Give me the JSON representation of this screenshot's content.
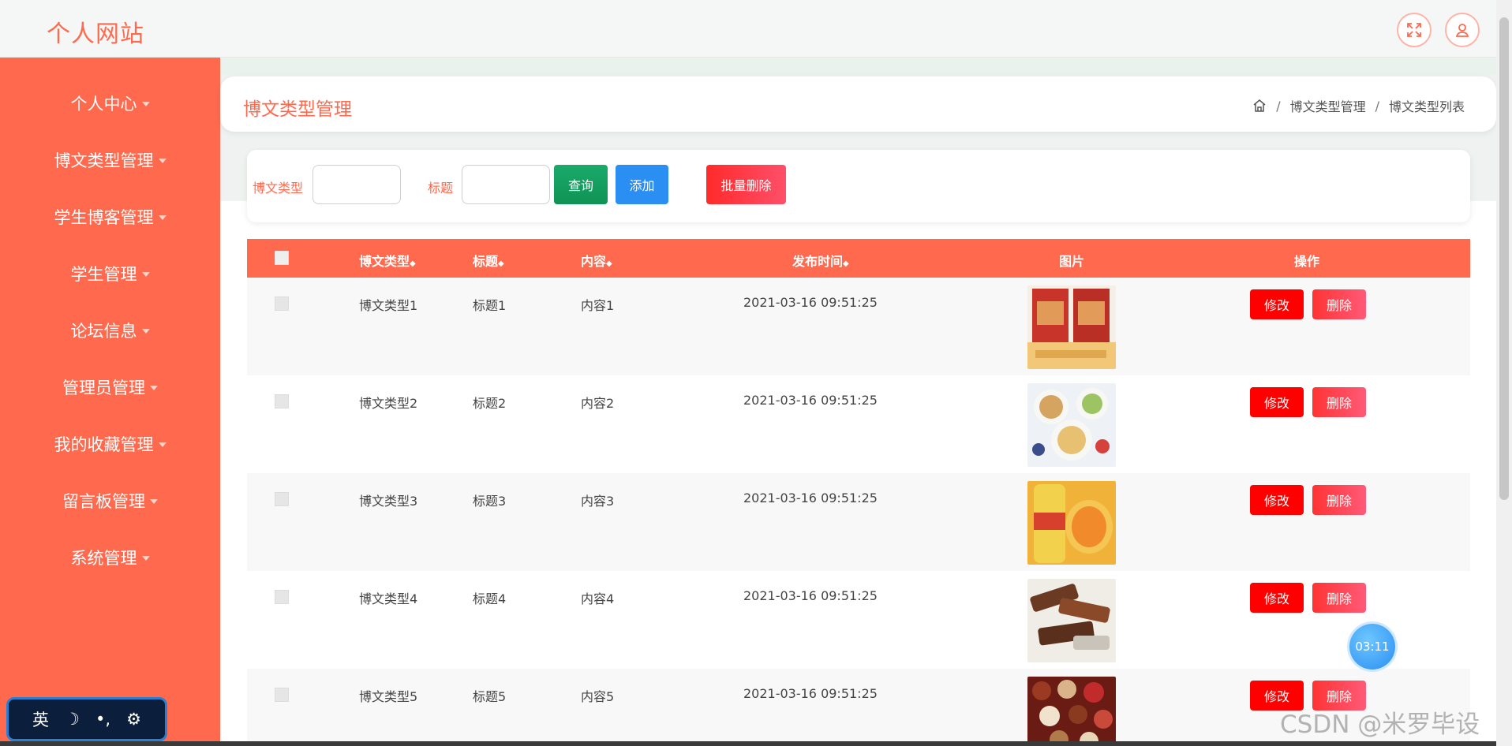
{
  "app": {
    "title": "个人网站"
  },
  "header": {
    "fullscreen_icon": "expand-icon",
    "user_icon": "user-icon"
  },
  "sidebar": {
    "items": [
      {
        "label": "个人中心"
      },
      {
        "label": "博文类型管理"
      },
      {
        "label": "学生博客管理"
      },
      {
        "label": "学生管理"
      },
      {
        "label": "论坛信息"
      },
      {
        "label": "管理员管理"
      },
      {
        "label": "我的收藏管理"
      },
      {
        "label": "留言板管理"
      },
      {
        "label": "系统管理"
      }
    ]
  },
  "page": {
    "title": "博文类型管理",
    "breadcrumb": {
      "level1": "博文类型管理",
      "level2": "博文类型列表"
    }
  },
  "search": {
    "type_label": "博文类型",
    "type_value": "",
    "title_label": "标题",
    "title_value": "",
    "query_label": "查询",
    "add_label": "添加",
    "batch_delete_label": "批量删除"
  },
  "table": {
    "headers": [
      "博文类型",
      "标题",
      "内容",
      "发布时间",
      "图片",
      "操作"
    ],
    "sort_glyph": "◆",
    "edit_label": "修改",
    "delete_label": "删除",
    "rows": [
      {
        "type": "博文类型1",
        "title": "标题1",
        "content": "内容1",
        "time": "2021-03-16 09:51:25"
      },
      {
        "type": "博文类型2",
        "title": "标题2",
        "content": "内容2",
        "time": "2021-03-16 09:51:25"
      },
      {
        "type": "博文类型3",
        "title": "标题3",
        "content": "内容3",
        "time": "2021-03-16 09:51:25"
      },
      {
        "type": "博文类型4",
        "title": "标题4",
        "content": "内容4",
        "time": "2021-03-16 09:51:25"
      },
      {
        "type": "博文类型5",
        "title": "标题5",
        "content": "内容5",
        "time": "2021-03-16 09:51:25"
      }
    ]
  },
  "timer": {
    "text": "03:11"
  },
  "ime": {
    "lang": "英",
    "moon": "☽",
    "punct": "•,",
    "gear": "⚙"
  },
  "watermark": "CSDN @米罗毕设",
  "colors": {
    "accent": "#ff6a4f",
    "edit": "#ff0000",
    "add": "#2a8ef2",
    "query": "#109355"
  }
}
